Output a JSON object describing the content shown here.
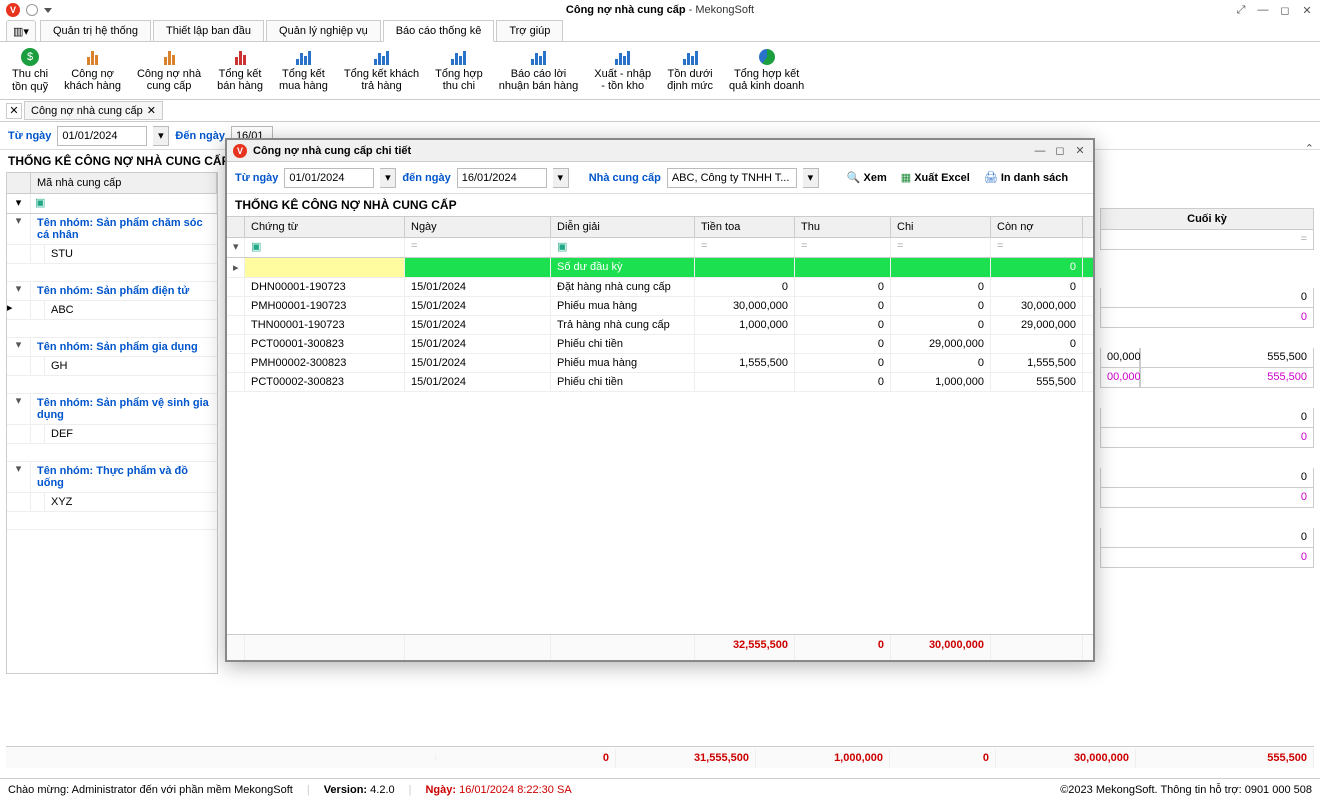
{
  "title": {
    "main": "Công nợ nhà cung cấp",
    "suffix": " - MekongSoft"
  },
  "menu": {
    "tabs": [
      "Quản trị hệ thống",
      "Thiết lập ban đầu",
      "Quản lý nghiệp vụ",
      "Báo cáo thống kê",
      "Trợ giúp"
    ],
    "active_idx": 3
  },
  "ribbon": [
    {
      "label": "Thu chi\ntồn quỹ"
    },
    {
      "label": "Công nợ\nkhách hàng"
    },
    {
      "label": "Công nợ nhà\ncung cấp"
    },
    {
      "label": "Tổng kết\nbán hàng"
    },
    {
      "label": "Tổng kết\nmua hàng"
    },
    {
      "label": "Tổng kết khách\ntrả hàng"
    },
    {
      "label": "Tổng hợp\nthu chi"
    },
    {
      "label": "Báo cáo lời\nnhuận bán hàng"
    },
    {
      "label": "Xuất - nhập\n- tồn kho"
    },
    {
      "label": "Tồn dưới\nđịnh mức"
    },
    {
      "label": "Tổng hợp kết\nquả kinh doanh"
    }
  ],
  "doctab": {
    "label": "Công nợ nhà cung cấp"
  },
  "filter": {
    "from_label": "Từ ngày",
    "from": "01/01/2024",
    "to_label": "Đến ngày",
    "to": "16/01"
  },
  "main_title": "THỐNG KÊ CÔNG NỢ NHÀ CUNG CẤP",
  "supplier_header": "Mã nhà cung cấp",
  "groups": [
    {
      "name": "Tên nhóm: Sản phẩm chăm sóc cá nhân",
      "code": "STU"
    },
    {
      "name": "Tên nhóm: Sản phẩm điện tử",
      "code": "ABC"
    },
    {
      "name": "Tên nhóm: Sản phẩm gia dụng",
      "code": "GH"
    },
    {
      "name": "Tên nhóm: Sản phẩm vệ sinh gia dụng",
      "code": "DEF"
    },
    {
      "name": "Tên nhóm: Thực phẩm và đồ uống",
      "code": "XYZ"
    }
  ],
  "right": {
    "header": "Cuối kỳ",
    "rows": [
      "",
      "0",
      "0",
      "0",
      "0",
      "555,500",
      "555,500",
      "",
      "0",
      "0",
      "",
      "0",
      "0",
      "",
      "0",
      "0"
    ],
    "extra1": "00,000",
    "extra1b": "555,500",
    "extra2": "00,000",
    "extra2b": "555,500"
  },
  "bg_totals": [
    "0",
    "31,555,500",
    "1,000,000",
    "0",
    "30,000,000",
    "555,500"
  ],
  "dialog": {
    "title": "Công nợ nhà cung cấp chi tiết",
    "from_label": "Từ ngày",
    "from": "01/01/2024",
    "to_label": "đến ngày",
    "to": "16/01/2024",
    "supplier_label": "Nhà cung cấp",
    "supplier": "ABC, Công ty TNHH T...",
    "btn_view": "Xem",
    "btn_excel": "Xuất Excel",
    "btn_print": "In danh sách",
    "body_title": "THỐNG KÊ CÔNG NỢ NHÀ CUNG CẤP",
    "headers": [
      "Chứng từ",
      "Ngày",
      "Diễn giải",
      "Tiền toa",
      "Thu",
      "Chi",
      "Còn nợ"
    ],
    "opening": {
      "label": "Số dư đầu kỳ",
      "val": "0"
    },
    "rows": [
      {
        "ct": "DHN00001-190723",
        "ngay": "15/01/2024",
        "dg": "Đặt hàng nhà cung cấp",
        "toa": "0",
        "thu": "0",
        "chi": "0",
        "no": "0"
      },
      {
        "ct": "PMH00001-190723",
        "ngay": "15/01/2024",
        "dg": "Phiếu mua hàng",
        "toa": "30,000,000",
        "thu": "0",
        "chi": "0",
        "no": "30,000,000"
      },
      {
        "ct": "THN00001-190723",
        "ngay": "15/01/2024",
        "dg": "Trả hàng nhà cung cấp",
        "toa": "1,000,000",
        "thu": "0",
        "chi": "0",
        "no": "29,000,000"
      },
      {
        "ct": "PCT00001-300823",
        "ngay": "15/01/2024",
        "dg": "Phiếu chi tiền",
        "toa": "",
        "thu": "0",
        "chi": "29,000,000",
        "no": "0"
      },
      {
        "ct": "PMH00002-300823",
        "ngay": "15/01/2024",
        "dg": "Phiếu mua hàng",
        "toa": "1,555,500",
        "thu": "0",
        "chi": "0",
        "no": "1,555,500"
      },
      {
        "ct": "PCT00002-300823",
        "ngay": "15/01/2024",
        "dg": "Phiếu chi tiền",
        "toa": "",
        "thu": "0",
        "chi": "1,000,000",
        "no": "555,500"
      }
    ],
    "totals": {
      "toa": "32,555,500",
      "thu": "0",
      "chi": "30,000,000"
    }
  },
  "status": {
    "welcome": "Chào mừng: Administrator đến với phần mềm MekongSoft",
    "version_label": "Version:",
    "version": "4.2.0",
    "date_label": "Ngày:",
    "date": "16/01/2024 8:22:30 SA",
    "copyright": "©2023 MekongSoft. Thông tin hỗ trợ: 0901 000 508"
  }
}
